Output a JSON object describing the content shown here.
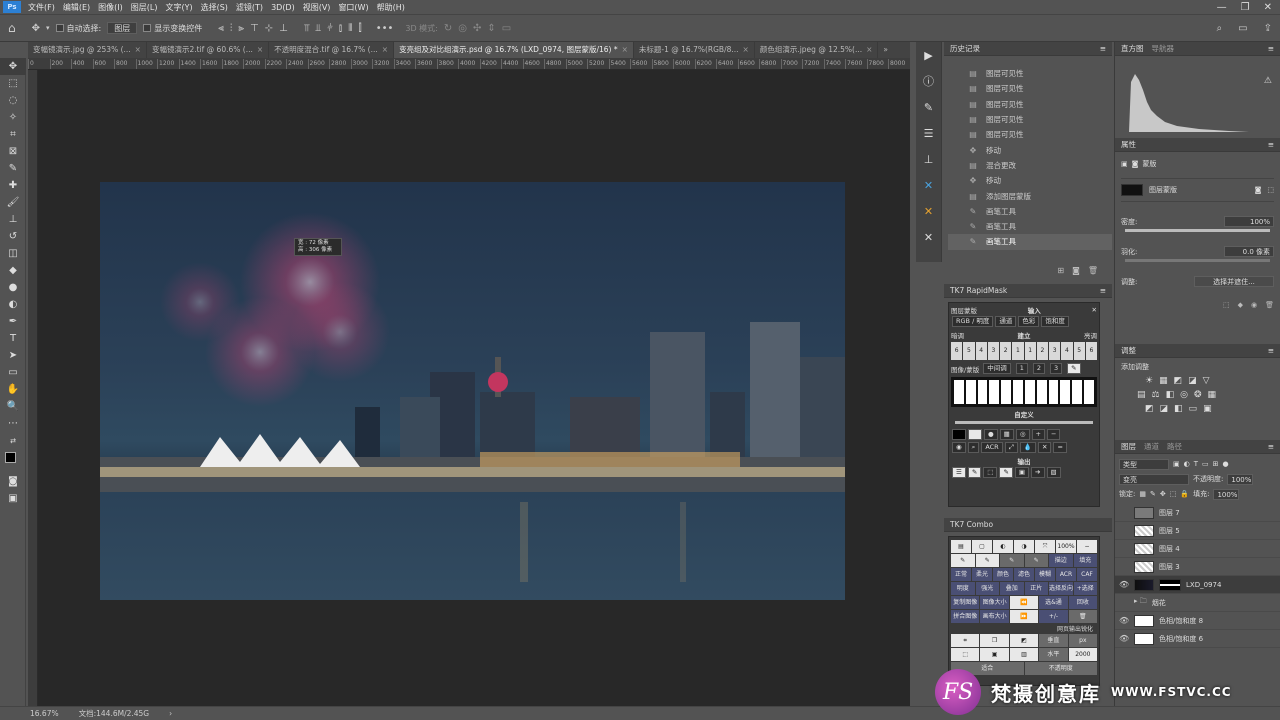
{
  "menubar": {
    "logo": "Ps",
    "items": [
      "文件(F)",
      "编辑(E)",
      "图像(I)",
      "图层(L)",
      "文字(Y)",
      "选择(S)",
      "滤镜(T)",
      "3D(D)",
      "视图(V)",
      "窗口(W)",
      "帮助(H)"
    ]
  },
  "options": {
    "auto_select_label": "自动选择:",
    "auto_select_value": "图层",
    "show_transform_label": "显示变换控件",
    "mode_3d_label": "3D 模式:"
  },
  "tabs": [
    {
      "label": "变幅镜演示.jpg @ 253% (..."
    },
    {
      "label": "变幅镜演示2.tif @ 60.6% (..."
    },
    {
      "label": "不透明度混合.tif @ 16.7% (..."
    },
    {
      "label": "变亮组及对比组演示.psd @ 16.7% (LXD_0974, 图层蒙版/16) *"
    },
    {
      "label": "未标题-1 @ 16.7%(RGB/8..."
    },
    {
      "label": "颜色组演示.jpeg @ 12.5%(..."
    }
  ],
  "ruler_marks": [
    "0",
    "200",
    "400",
    "600",
    "800",
    "1000",
    "1200",
    "1400",
    "1600",
    "1800",
    "2000",
    "2200",
    "2400",
    "2600",
    "2800",
    "3000",
    "3200",
    "3400",
    "3600",
    "3800",
    "4000",
    "4200",
    "4400",
    "4600",
    "4800",
    "5000",
    "5200",
    "5400",
    "5600",
    "5800",
    "6000",
    "6200",
    "6400",
    "6600",
    "6800",
    "7000",
    "7200",
    "7400",
    "7600",
    "7800",
    "8000",
    "8200"
  ],
  "tooltip": {
    "w": "宽 : 72 像素",
    "h": "高 : 306 像素"
  },
  "status": {
    "zoom": "16.67%",
    "doc": "文档:144.6M/2.45G"
  },
  "history": {
    "title": "历史记录",
    "items": [
      {
        "icon": "doc",
        "label": "图层可见性"
      },
      {
        "icon": "doc",
        "label": "图层可见性"
      },
      {
        "icon": "doc",
        "label": "图层可见性"
      },
      {
        "icon": "doc",
        "label": "图层可见性"
      },
      {
        "icon": "doc",
        "label": "图层可见性"
      },
      {
        "icon": "move",
        "label": "移动"
      },
      {
        "icon": "doc",
        "label": "混合更改"
      },
      {
        "icon": "move",
        "label": "移动"
      },
      {
        "icon": "doc",
        "label": "添加图层蒙版"
      },
      {
        "icon": "brush",
        "label": "画笔工具"
      },
      {
        "icon": "brush",
        "label": "画笔工具"
      },
      {
        "icon": "brush",
        "label": "画笔工具"
      }
    ]
  },
  "rapidmask": {
    "title": "TK7 RapidMask",
    "input_label": "输入",
    "mask_label": "图层蒙版",
    "row1": [
      "RGB / 明度",
      "通道",
      "色彩",
      "饱和度"
    ],
    "dark": "暗调",
    "build": "建立",
    "light": "亮调",
    "keys": [
      "6",
      "5",
      "4",
      "3",
      "2",
      "1",
      "1",
      "2",
      "3",
      "4",
      "5",
      "6"
    ],
    "image_label": "图像/蒙版",
    "mid": "中间调",
    "mid_keys": [
      "1",
      "2",
      "3"
    ],
    "custom": "自定义",
    "acr": "ACR",
    "output": "输出"
  },
  "combo": {
    "title": "TK7 Combo",
    "pct": "100%",
    "rows": [
      [
        "正常",
        "柔光",
        "颜色",
        "滤色",
        "模糊",
        "ACR",
        "CAF"
      ],
      [
        "明度",
        "强光",
        "叠加",
        "正片",
        "选择反向",
        "+选择"
      ],
      [
        "复制图像",
        "图像大小",
        "选&通",
        "回收"
      ],
      [
        "拼合图像",
        "画布大小",
        "+/-",
        "网页输出锐化"
      ]
    ],
    "stroke": "描边",
    "fill": "填充",
    "vert": "垂直",
    "horiz": "水平",
    "size": "2000",
    "unit": "px",
    "fit": "适合",
    "opacity": "不透明度"
  },
  "histogram": {
    "tab1": "直方图",
    "tab2": "导航器"
  },
  "properties": {
    "title": "属性",
    "subtitle": "蒙版",
    "mask_label": "图层蒙版",
    "density_label": "密度:",
    "density_value": "100%",
    "feather_label": "羽化:",
    "feather_value": "0.0 像素",
    "adjust_label": "调整:",
    "select_btn": "选择并遮住..."
  },
  "adjustments": {
    "title": "调整",
    "add_label": "添加调整"
  },
  "layers": {
    "tabs": [
      "图层",
      "通道",
      "路径"
    ],
    "kind": "类型",
    "blend": "变亮",
    "opacity_label": "不透明度:",
    "opacity_value": "100%",
    "lock_label": "锁定:",
    "fill_label": "填充:",
    "fill_value": "100%",
    "items": [
      {
        "name": "图层 7",
        "thumb": "gray",
        "eye": ""
      },
      {
        "name": "图层 5",
        "thumb": "check",
        "eye": ""
      },
      {
        "name": "图层 4",
        "thumb": "check",
        "eye": ""
      },
      {
        "name": "图层 3",
        "thumb": "check",
        "eye": ""
      },
      {
        "name": "LXD_0974",
        "thumb": "dark",
        "eye": "👁"
      },
      {
        "name": "烟花",
        "thumb": "folder",
        "eye": ""
      },
      {
        "name": "色相/饱和度 8",
        "thumb": "white",
        "eye": "👁"
      },
      {
        "name": "色相/饱和度 6",
        "thumb": "white",
        "eye": "👁"
      }
    ]
  },
  "watermark": {
    "logo": "FS",
    "text": "梵摄创意库",
    "url": "WWW.FSTVC.CC"
  }
}
